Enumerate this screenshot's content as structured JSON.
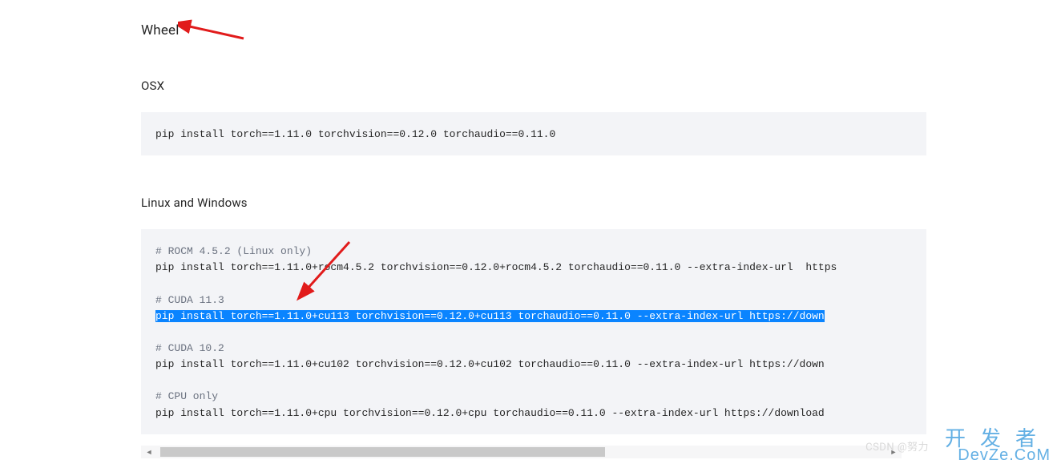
{
  "headings": {
    "wheel": "Wheel",
    "osx": "OSX",
    "linux_windows": "Linux and Windows"
  },
  "osx_block": {
    "line1": "pip install torch==1.11.0 torchvision==0.12.0 torchaudio==0.11.0"
  },
  "lw_block": {
    "c_rocm": "# ROCM 4.5.2 (Linux only)",
    "l_rocm": "pip install torch==1.11.0+rocm4.5.2 torchvision==0.12.0+rocm4.5.2 torchaudio==0.11.0 --extra-index-url  https",
    "c_cuda113": "# CUDA 11.3",
    "l_cuda113": "pip install torch==1.11.0+cu113 torchvision==0.12.0+cu113 torchaudio==0.11.0 --extra-index-url https://down",
    "c_cuda102": "# CUDA 10.2",
    "l_cuda102": "pip install torch==1.11.0+cu102 torchvision==0.12.0+cu102 torchaudio==0.11.0 --extra-index-url https://down",
    "c_cpu": "# CPU only",
    "l_cpu": "pip install torch==1.11.0+cpu torchvision==0.12.0+cpu torchaudio==0.11.0 --extra-index-url https://download"
  },
  "watermark": {
    "cn": "开发者",
    "en": "DevZe.CoM",
    "csdn": "CSDN @努力"
  },
  "arrows": {
    "color": "#e11b1b"
  }
}
